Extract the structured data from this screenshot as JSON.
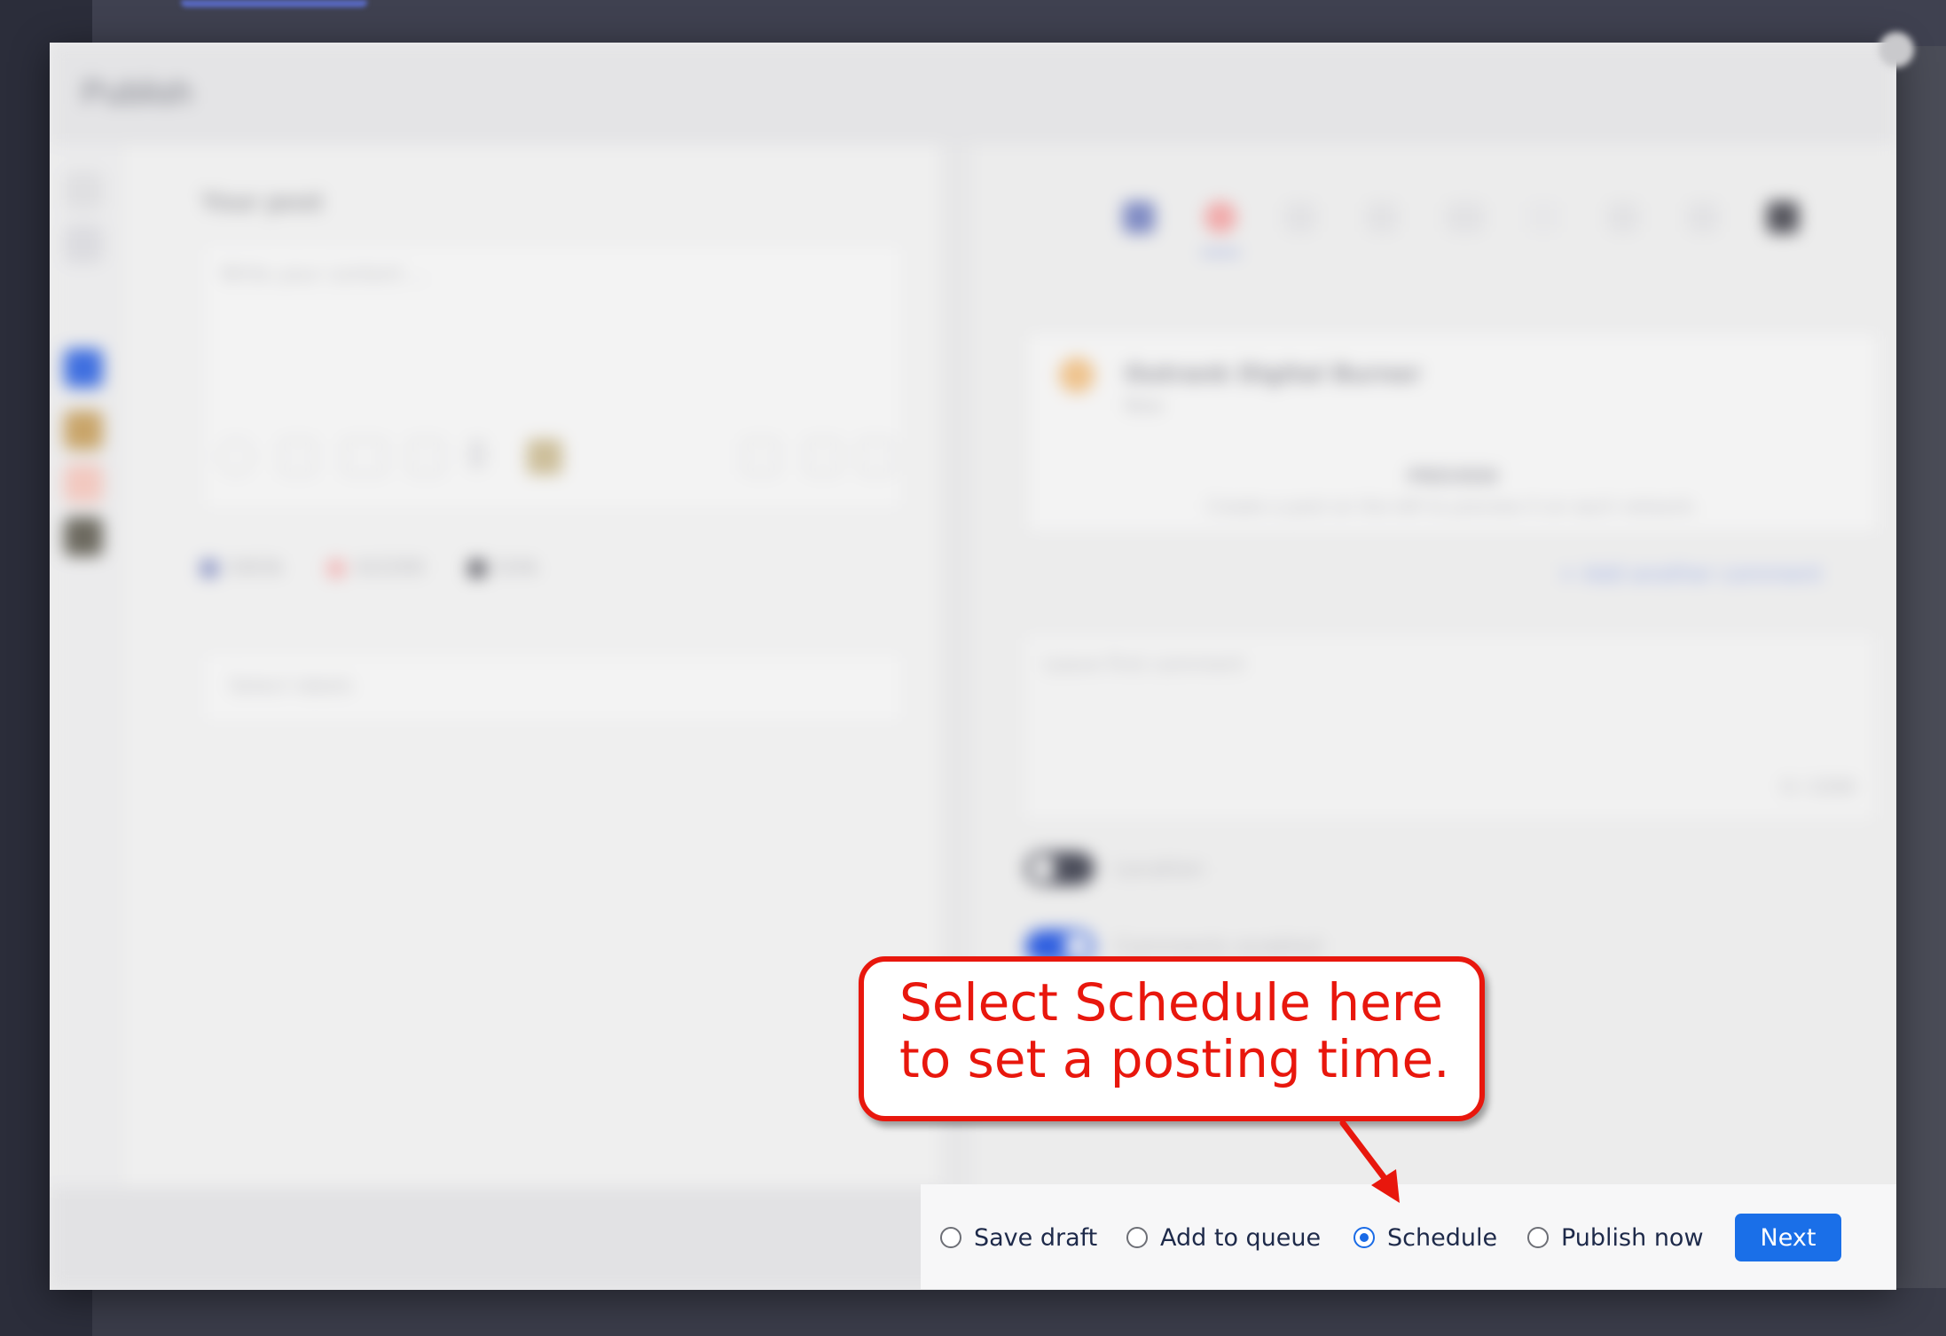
{
  "modal": {
    "title": "Publish",
    "left_panel": {
      "heading": "Your post",
      "editor_placeholder": "Write your content ...",
      "counts": [
        "0/63k",
        "0/2200",
        "0/4k"
      ],
      "labels_placeholder": "Select labels"
    },
    "right_panel": {
      "account_name": "Outrank Digital Burner",
      "account_sub": "Now",
      "preview_title": "PREVIEW",
      "preview_text": "Create a post on the left to preview it on each network.",
      "add_comment": "+ Add another comment",
      "comment_placeholder": "Leave first comment",
      "comment_count": "0 / 2200",
      "toggle_location": "Location",
      "toggle_comments": "Comments enabled"
    }
  },
  "footer": {
    "options": [
      {
        "label": "Save draft",
        "checked": false
      },
      {
        "label": "Add to queue",
        "checked": false
      },
      {
        "label": "Schedule",
        "checked": true
      },
      {
        "label": "Publish now",
        "checked": false
      }
    ],
    "next_label": "Next"
  },
  "callout": {
    "text": "Select Schedule here\nto set a posting time."
  },
  "colors": {
    "accent": "#1a6fe8",
    "callout_red": "#e8170d"
  }
}
